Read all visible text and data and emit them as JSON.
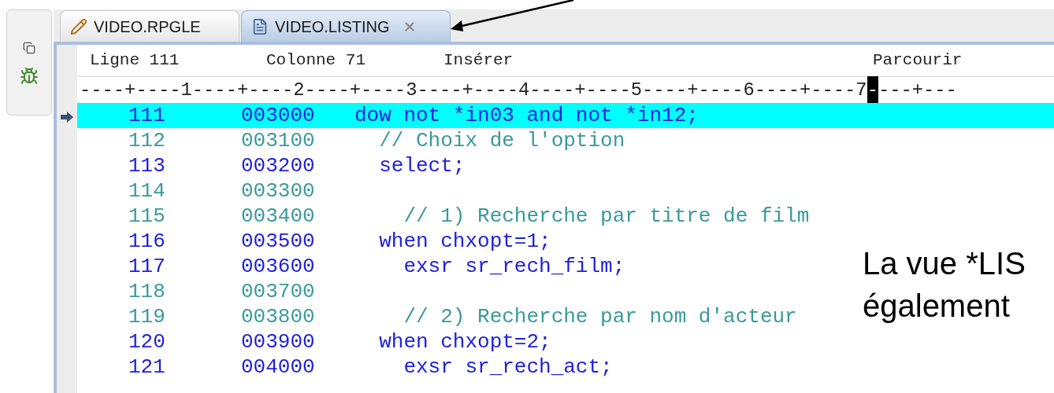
{
  "tabs": [
    {
      "label": "VIDEO.RPGLE",
      "kind": "source",
      "selected": false,
      "closable": false
    },
    {
      "label": "VIDEO.LISTING",
      "kind": "listing",
      "selected": true,
      "closable": true
    }
  ],
  "status": {
    "line": "Ligne 111",
    "column": "Colonne 71",
    "mode": "Insérer",
    "action": "Parcourir"
  },
  "ruler": {
    "before": "----+----1----+----2----+----3----+----4----+----5----+----6----+----7",
    "cursor": "-",
    "after": "---+---"
  },
  "rows": [
    {
      "number": "111",
      "sequence": "003000",
      "code": "dow not *in03 and not *in12;",
      "kind": "code",
      "selected": true
    },
    {
      "number": "112",
      "sequence": "003100",
      "code": "  // Choix de l'option",
      "kind": "comment",
      "selected": false
    },
    {
      "number": "113",
      "sequence": "003200",
      "code": "  select;",
      "kind": "code",
      "selected": false
    },
    {
      "number": "114",
      "sequence": "003300",
      "kind": "blank",
      "selected": false
    },
    {
      "number": "115",
      "sequence": "003400",
      "code": "    // 1) Recherche par titre de film",
      "kind": "comment",
      "selected": false
    },
    {
      "number": "116",
      "sequence": "003500",
      "code": "  when chxopt=1;",
      "kind": "code",
      "selected": false
    },
    {
      "number": "117",
      "sequence": "003600",
      "code": "    exsr sr_rech_film;",
      "kind": "code",
      "selected": false
    },
    {
      "number": "118",
      "sequence": "003700",
      "kind": "blank",
      "selected": false
    },
    {
      "number": "119",
      "sequence": "003800",
      "code": "    // 2) Recherche par nom d'acteur",
      "kind": "comment",
      "selected": false
    },
    {
      "number": "120",
      "sequence": "003900",
      "code": "  when chxopt=2;",
      "kind": "code",
      "selected": false
    },
    {
      "number": "121",
      "sequence": "004000",
      "code": "    exsr sr_rech_act;",
      "kind": "code",
      "selected": false
    }
  ],
  "caption_lines": [
    "La vue *LIS",
    "également"
  ]
}
